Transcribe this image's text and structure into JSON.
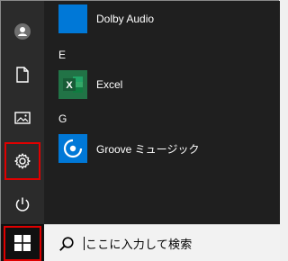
{
  "start_menu": {
    "apps": [
      {
        "label": "Dolby Audio",
        "icon": "dolby-audio-icon"
      },
      {
        "label": "Excel",
        "icon": "excel-icon"
      },
      {
        "label": "Groove ミュージック",
        "icon": "groove-music-icon"
      }
    ],
    "sections": [
      "E",
      "G"
    ],
    "rail": [
      "user-avatar-icon",
      "document-icon",
      "pictures-icon",
      "settings-gear-icon",
      "power-icon"
    ],
    "highlight_color": "#e00000",
    "tile_colors": {
      "dolby": "#0078d7",
      "excel": "#217346",
      "groove": "#0078d7"
    }
  },
  "taskbar": {
    "start_icon": "windows-logo-icon",
    "search_placeholder": "ここに入力して検索"
  }
}
